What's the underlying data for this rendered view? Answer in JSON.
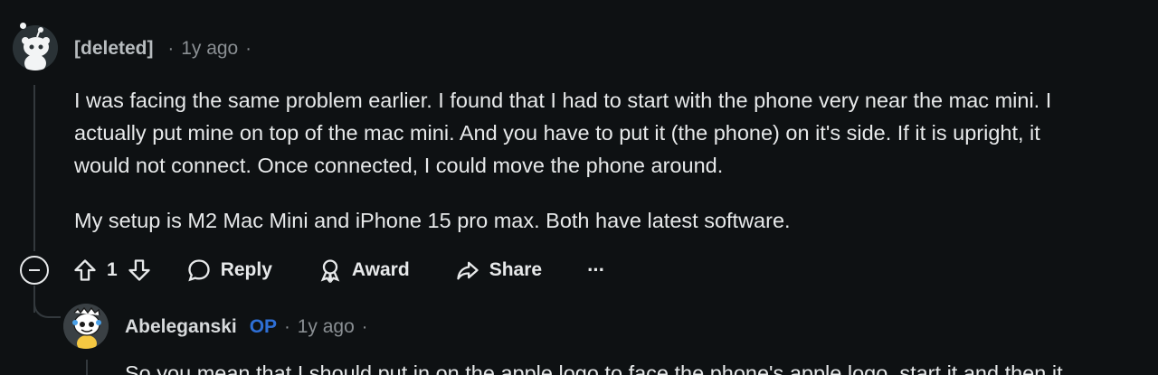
{
  "comment": {
    "author": "[deleted]",
    "time": "1y ago",
    "paragraphs": [
      "I was facing the same problem earlier. I found that I had to start with the phone very near the mac mini. I",
      "actually put mine on top of the mac mini. And you have to put it (the phone) on it's side. If it is upright, it",
      "would not connect. Once connected, I could move the phone around.",
      "My setup is M2 Mac Mini and iPhone 15 pro max. Both have latest software."
    ],
    "actions": {
      "vote_count": "1",
      "reply": "Reply",
      "award": "Award",
      "share": "Share",
      "more": "···"
    }
  },
  "reply": {
    "author": "Abeleganski",
    "op_badge": "OP",
    "time": "1y ago",
    "preview": "So you mean that I should put in on the apple logo to face the phone's apple logo, start it and then it"
  },
  "colors": {
    "background": "#0e1113",
    "op_blue": "#2e6fd6",
    "muted": "#8a8f93"
  }
}
